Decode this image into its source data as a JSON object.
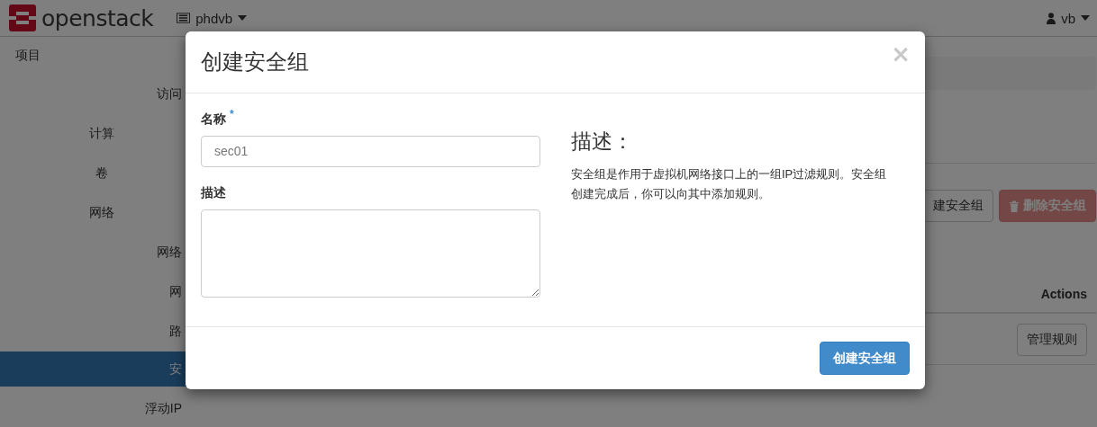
{
  "topbar": {
    "logo": "openstack",
    "project_menu": {
      "label": "phdvb"
    },
    "user_menu": {
      "label": "vb"
    }
  },
  "sidebar": {
    "items": [
      {
        "label": "项目",
        "kind": "dashboard",
        "children": [
          {
            "label": "访问",
            "kind": "panel",
            "selected": false
          },
          {
            "label": "计算",
            "kind": "group"
          },
          {
            "label": "卷",
            "kind": "group"
          },
          {
            "label": "网络",
            "kind": "group",
            "children": [
              {
                "label": "网络",
                "kind": "panel",
                "selected": false
              },
              {
                "label": "网",
                "kind": "panel",
                "selected": false
              },
              {
                "label": "路",
                "kind": "panel",
                "selected": false
              },
              {
                "label": "安",
                "kind": "panel",
                "selected": true
              },
              {
                "label": "浮动IP",
                "kind": "panel",
                "selected": false
              }
            ]
          }
        ]
      }
    ]
  },
  "main": {
    "buttons": [
      {
        "label": "建安全组",
        "kind": "default",
        "disabled": false
      },
      {
        "label": "删除安全组",
        "kind": "danger",
        "disabled": true
      }
    ],
    "table": {
      "columns": [
        "Actions"
      ],
      "rows": [
        {
          "action": "管理规则"
        }
      ]
    }
  },
  "modal": {
    "title": "创建安全组",
    "close": "×",
    "fields": [
      {
        "label": "名称",
        "required": true,
        "required_mark": "*",
        "kind": "input",
        "value": "sec01"
      },
      {
        "label": "描述",
        "required": false,
        "kind": "textarea"
      }
    ],
    "help": {
      "title": "描述：",
      "text": "安全组是作用于虚拟机网络接口上的一组IP过滤规则。安全组创建完成后，你可以向其中添加规则。"
    },
    "submit": "创建安全组"
  }
}
